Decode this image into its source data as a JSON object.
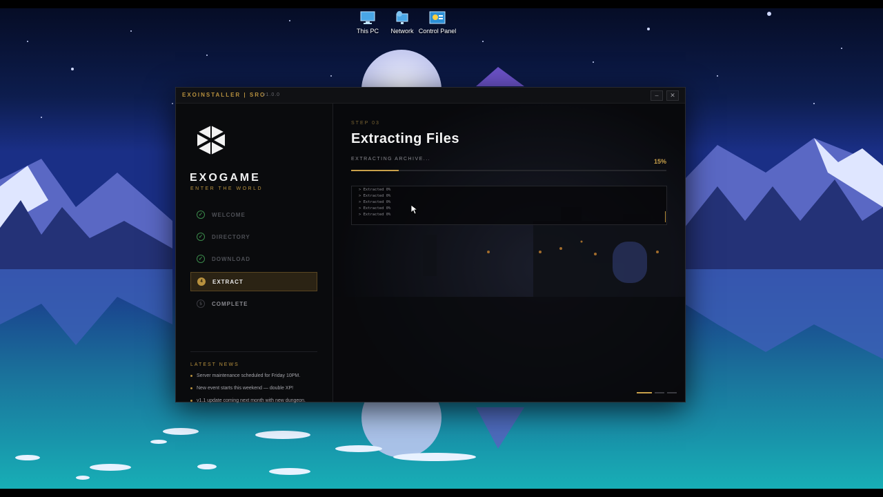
{
  "desktop": {
    "icons": [
      {
        "label": "This PC",
        "icon": "computer-icon"
      },
      {
        "label": "Network",
        "icon": "network-icon"
      },
      {
        "label": "Control Panel",
        "icon": "control-panel-icon"
      }
    ]
  },
  "installer": {
    "title": "EXOINSTALLER | SRO",
    "version": "v1.0.0",
    "window_controls": {
      "minimize": "–",
      "close": "✕"
    },
    "brand": {
      "name": "EXOGAME",
      "tagline": "ENTER THE WORLD"
    },
    "steps": [
      {
        "num": "✓",
        "label": "WELCOME",
        "state": "done"
      },
      {
        "num": "✓",
        "label": "DIRECTORY",
        "state": "done"
      },
      {
        "num": "✓",
        "label": "DOWNLOAD",
        "state": "done"
      },
      {
        "num": "4",
        "label": "EXTRACT",
        "state": "active"
      },
      {
        "num": "5",
        "label": "COMPLETE",
        "state": "pending"
      }
    ],
    "news": {
      "heading": "LATEST NEWS",
      "items": [
        "Server maintenance scheduled for Friday 10PM.",
        "New event starts this weekend — double XP!",
        "v1.1 update coming next month with new dungeon."
      ]
    },
    "main": {
      "step_number": "STEP 03",
      "title": "Extracting Files",
      "status": "EXTRACTING ARCHIVE...",
      "percent_label": "15%",
      "progress": 0.15,
      "log": [
        "> Extracted 0%",
        "> Extracted 0%",
        "> Extracted 0%",
        "> Extracted 0%",
        "> Extracted 0%"
      ]
    },
    "colors": {
      "accent": "#c9a14a",
      "success": "#49b25c",
      "background": "#0b0c0f"
    }
  }
}
